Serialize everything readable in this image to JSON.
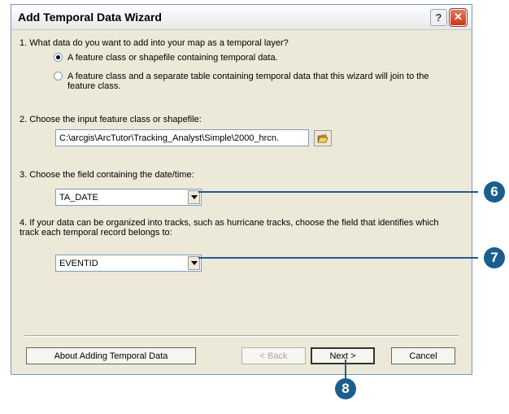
{
  "window": {
    "title": "Add Temporal Data Wizard"
  },
  "step1": {
    "question": "1.  What data do you want to add into your map as a temporal layer?",
    "options": [
      {
        "label": "A feature class or shapefile containing temporal data.",
        "selected": true
      },
      {
        "label": "A feature class and a separate table containing temporal data that this wizard will join to the feature class.",
        "selected": false
      }
    ]
  },
  "step2": {
    "question": "2.  Choose the input feature class or shapefile:",
    "path_value": "C:\\arcgis\\ArcTutor\\Tracking_Analyst\\Simple\\2000_hrcn."
  },
  "step3": {
    "question": "3.  Choose the field containing the date/time:",
    "selected": "TA_DATE"
  },
  "step4": {
    "question": "4.  If your data can be organized into tracks, such as hurricane tracks, choose the field that identifies which track each temporal record belongs to:",
    "selected": "EVENTID"
  },
  "buttons": {
    "about": "About Adding Temporal Data",
    "back": "< Back",
    "next": "Next >",
    "cancel": "Cancel"
  },
  "callouts": {
    "c6": "6",
    "c7": "7",
    "c8": "8"
  },
  "colors": {
    "callout": "#1c5d8e",
    "dialog_bg": "#ece9d8"
  }
}
